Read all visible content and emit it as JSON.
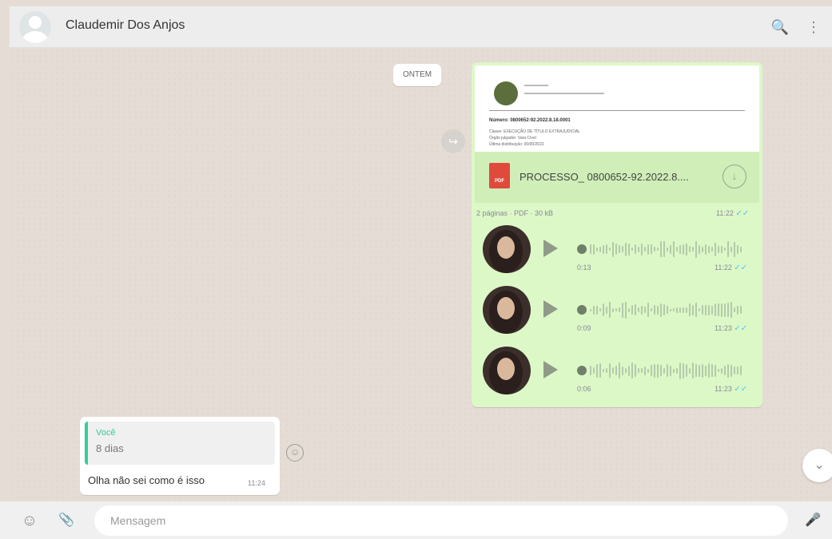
{
  "header": {
    "contact_name": "Claudemir Dos Anjos",
    "search_icon": "🔍",
    "menu_icon": "⋮"
  },
  "chat": {
    "date_separator": "ONTEM",
    "document_message": {
      "file_name": "PROCESSO_ 0800652-92.2022.8....",
      "file_type_label": "PDF",
      "meta": "2 páginas · PDF · 30 kB",
      "time": "11:22",
      "preview": {
        "heading": "Número: 0800652-92.2022.8.18.0001",
        "line1": "Classe: EXECUÇÃO DE TÍTULO EXTRAJUDICIAL",
        "line2": "Órgão julgador: Vara Cível",
        "line3": "Última distribuição: 00/00/2022"
      }
    },
    "audio_messages": [
      {
        "duration": "0:13",
        "time": "11:22"
      },
      {
        "duration": "0:09",
        "time": "11:23"
      },
      {
        "duration": "0:06",
        "time": "11:23"
      }
    ],
    "incoming_message": {
      "quote_author": "Você",
      "quote_text": "8 dias",
      "text": "Olha não sei como é isso",
      "time": "11:24"
    },
    "forward_icon": "↪",
    "smile_icon": "☺",
    "scroll_down_icon": "⌄"
  },
  "footer": {
    "emoji_icon": "☺",
    "attach_icon": "📎",
    "input_placeholder": "Mensagem",
    "mic_icon": "🎤"
  },
  "colors": {
    "outgoing_bubble": "#dcf8c6",
    "incoming_bubble": "#ffffff",
    "accent": "#35cd96",
    "read_check": "#4fc3f7"
  }
}
